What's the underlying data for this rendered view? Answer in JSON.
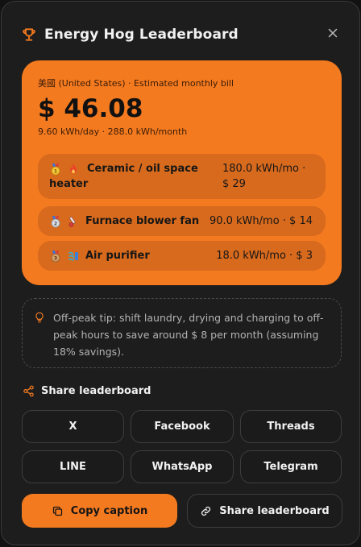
{
  "header": {
    "title": "Energy Hog Leaderboard",
    "icon": "trophy-icon",
    "close_icon": "close-icon"
  },
  "summary": {
    "region": "美國 (United States) · Estimated monthly bill",
    "bill": "$ 46.08",
    "usage": "9.60 kWh/day · 288.0 kWh/month"
  },
  "leaderboard": [
    {
      "rank": 1,
      "medal_icon": "gold-medal-icon",
      "appliance_icon": "fire-icon",
      "name": "Ceramic / oil space heater",
      "stats": "180.0 kWh/mo · $ 29"
    },
    {
      "rank": 2,
      "medal_icon": "silver-medal-icon",
      "appliance_icon": "thermometer-icon",
      "name": "Furnace blower fan",
      "stats": "90.0 kWh/mo · $ 14"
    },
    {
      "rank": 3,
      "medal_icon": "bronze-medal-icon",
      "appliance_icon": "fan-icon",
      "name": "Air purifier",
      "stats": "18.0 kWh/mo · $ 3"
    }
  ],
  "tip": {
    "icon": "lightbulb-icon",
    "text": "Off-peak tip: shift laundry, drying and charging to off-peak hours to save around $ 8 per month (assuming 18% savings)."
  },
  "share": {
    "heading": "Share leaderboard",
    "icon": "share-icon",
    "networks": [
      "X",
      "Facebook",
      "Threads",
      "LINE",
      "WhatsApp",
      "Telegram"
    ],
    "copy_label": "Copy caption",
    "copy_icon": "copy-icon",
    "share_label": "Share leaderboard",
    "share_link_icon": "link-icon"
  },
  "colors": {
    "accent": "#f47a20",
    "panel": "#1d1d1d",
    "item": "#d86a1d"
  }
}
